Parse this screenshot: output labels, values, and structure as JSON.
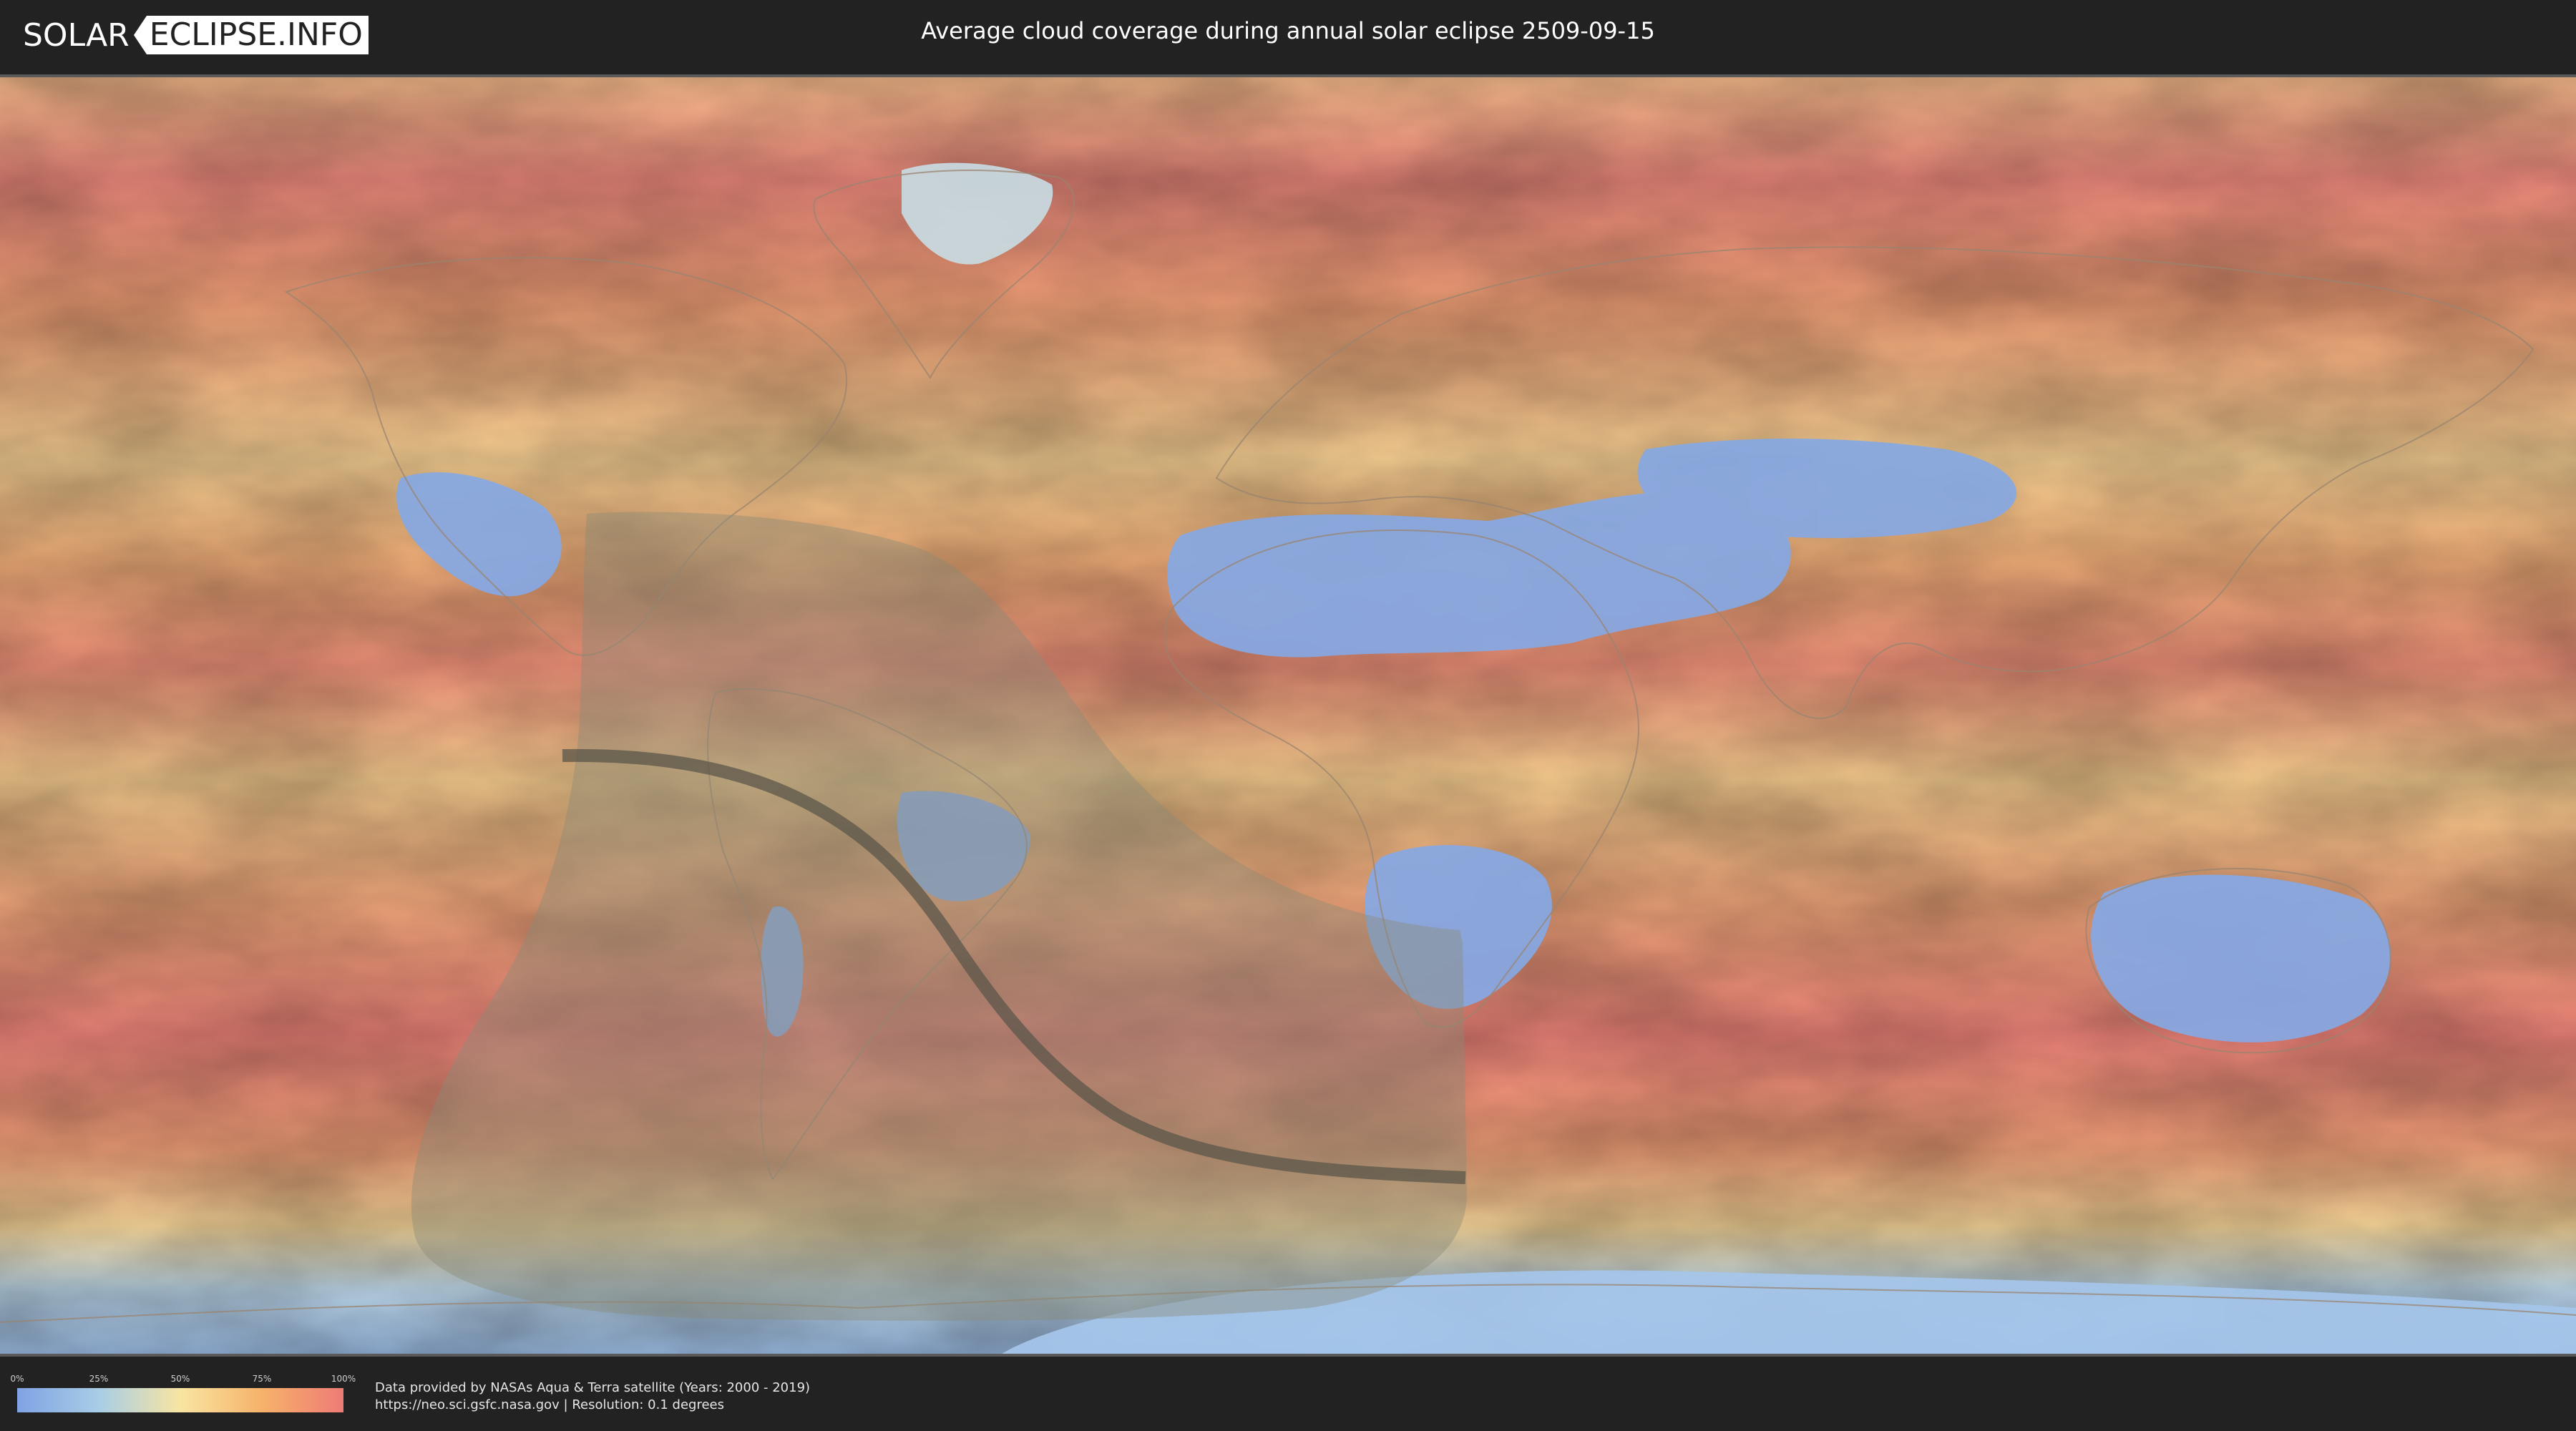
{
  "header": {
    "logo_left": "SOLAR",
    "logo_right": "ECLIPSE.INFO",
    "title": "Average cloud coverage during annual solar eclipse 2509-09-15"
  },
  "legend": {
    "ticks": [
      "0%",
      "25%",
      "50%",
      "75%",
      "100%"
    ],
    "tick_values": [
      0,
      25,
      50,
      75,
      100
    ],
    "colors": [
      "#7fa3e3",
      "#a8cde6",
      "#f8e5a2",
      "#f7b26a",
      "#ee7b76"
    ]
  },
  "footer": {
    "line1": "Data provided by NASAs Aqua & Terra satellite (Years: 2000 - 2019)",
    "line2": "https://neo.sci.gsfc.nasa.gov | Resolution: 0.1 degrees"
  },
  "map": {
    "projection": "equirectangular",
    "layers": [
      "cloud-coverage-heatmap",
      "coastlines",
      "eclipse-visibility-zone",
      "eclipse-central-path"
    ],
    "colors": {
      "clear": "#7fa3e3",
      "mid": "#f8e5a2",
      "cloudy": "#ee7b76",
      "eclipse_zone": "#8b8b78",
      "central_path": "#5b554a"
    }
  }
}
